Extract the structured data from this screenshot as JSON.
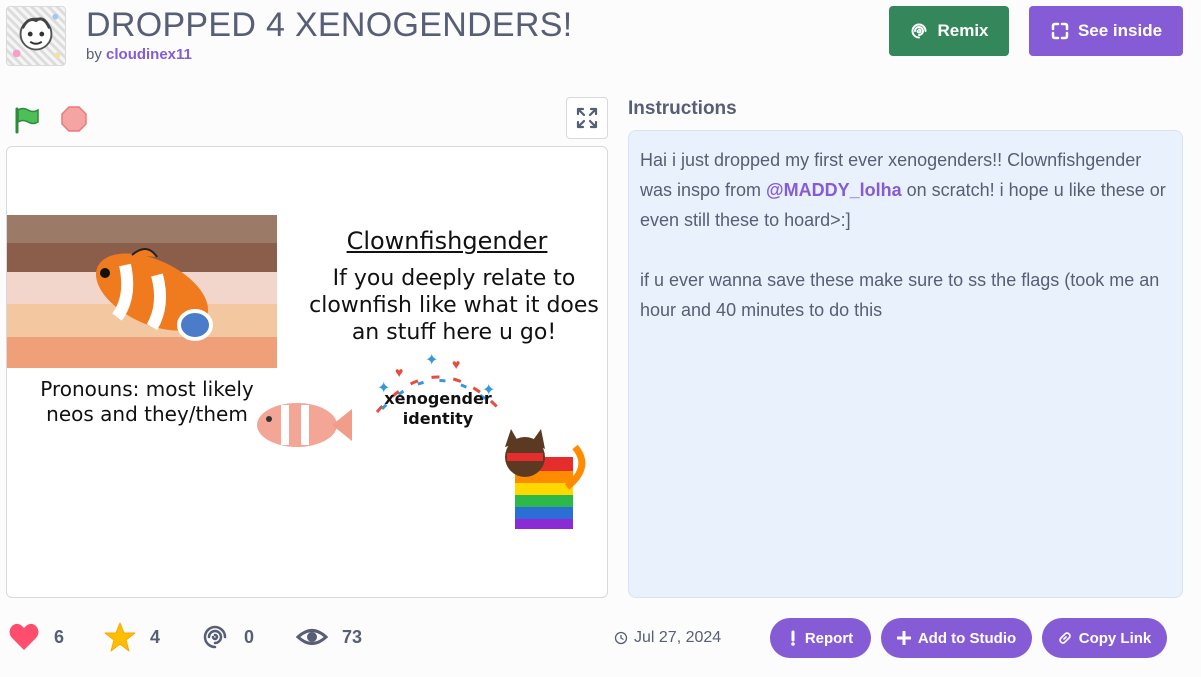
{
  "project": {
    "title": "DROPPED 4 XENOGENDERS!",
    "by_prefix": "by",
    "author": "cloudinex11"
  },
  "buttons": {
    "remix": "Remix",
    "see_inside": "See inside",
    "report": "Report",
    "add_to_studio": "Add to Studio",
    "copy_link": "Copy Link"
  },
  "stage": {
    "heading": "Clownfishgender",
    "description": "If you deeply relate to clownfish like what it does an stuff here u go!",
    "pronouns": "Pronouns: most likely neos and they/them",
    "xeno_label": "xenogender identity",
    "flag_colors": [
      "#9b7b68",
      "#8a5e4a",
      "#f2d6cc",
      "#f3c7a0",
      "#f0a078"
    ]
  },
  "instructions": {
    "title": "Instructions",
    "line1_a": "Hai i just dropped my first ever xenogenders!! Clownfishgender was inspo from ",
    "mention": "@MADDY_lolha",
    "line1_b": " on scratch! i hope u like these or even still these to hoard>:]",
    "line2": "if u ever wanna save these make sure to ss the flags (took me an hour and 40 minutes to do this"
  },
  "stats": {
    "loves": "6",
    "favorites": "4",
    "remixes": "0",
    "views": "73",
    "date": "Jul 27, 2024"
  },
  "colors": {
    "accent": "#855cd6",
    "remix_green": "#33875a",
    "instructions_bg": "#e9f1fc",
    "love_red": "#ff4d6d",
    "star_yellow": "#ffbf00"
  }
}
